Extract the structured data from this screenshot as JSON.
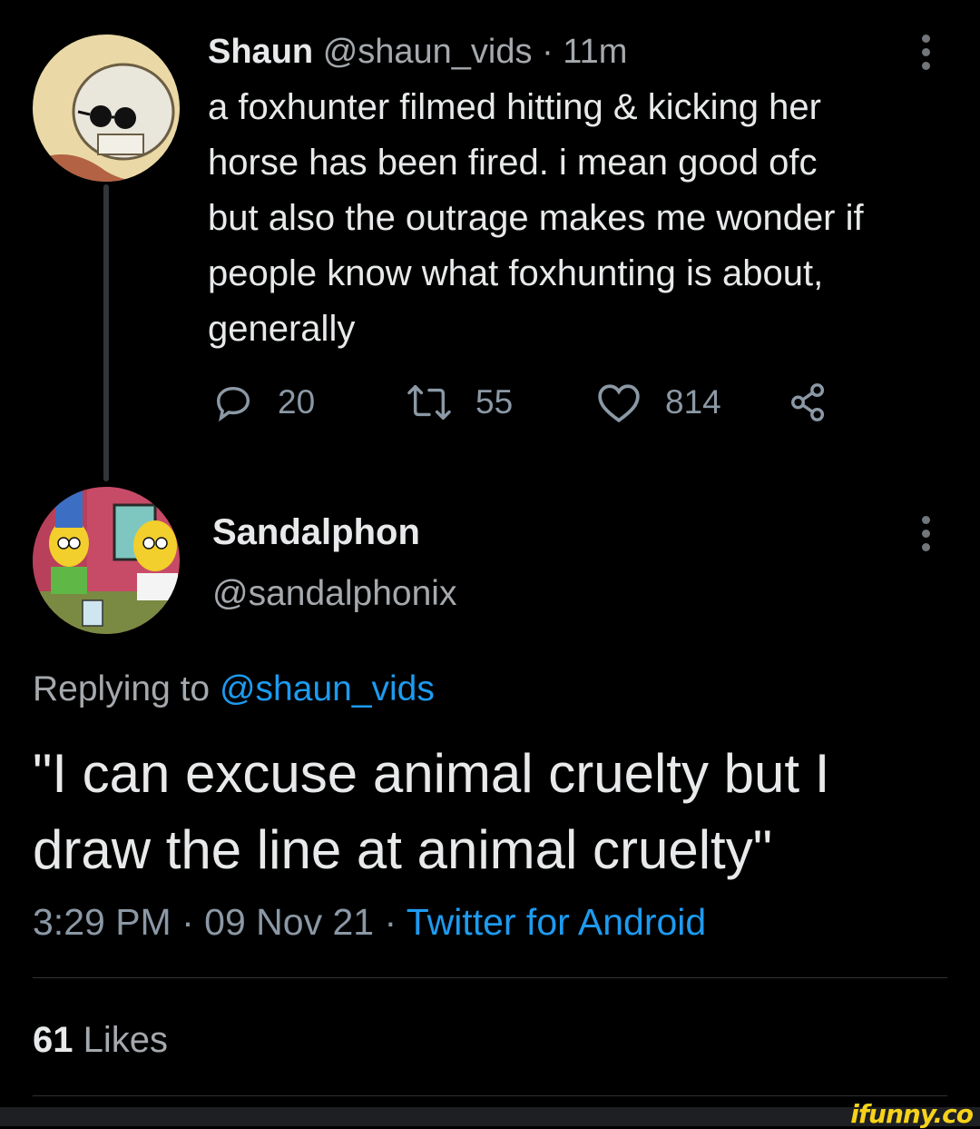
{
  "parent_tweet": {
    "display_name": "Shaun",
    "handle": "@shaun_vids",
    "separator": "·",
    "time": "11m",
    "text_lines": [
      "a foxhunter filmed hitting & kicking her",
      "horse has been fired. i mean good ofc",
      "but also the outrage makes me wonder if",
      "people know what foxhunting is about,",
      "generally"
    ],
    "actions": {
      "replies": "20",
      "retweets": "55",
      "likes": "814"
    },
    "icons": [
      "reply-icon",
      "retweet-icon",
      "like-icon",
      "share-icon",
      "more-icon"
    ]
  },
  "reply_tweet": {
    "display_name": "Sandalphon",
    "handle": "@sandalphonix",
    "replying_prefix": "Replying to",
    "replying_handle": "@shaun_vids",
    "text": "\"I can excuse animal cruelty but I draw the line at animal cruelty\"",
    "time": "3:29 PM",
    "date": "09 Nov 21",
    "sep": "·",
    "source": "Twitter for Android",
    "likes_count": "61",
    "likes_label": "Likes"
  },
  "watermark": "ifunny.co",
  "colors": {
    "background": "#000000",
    "text": "#e7e9ea",
    "muted": "#8b98a5",
    "link": "#1d9bf0"
  }
}
